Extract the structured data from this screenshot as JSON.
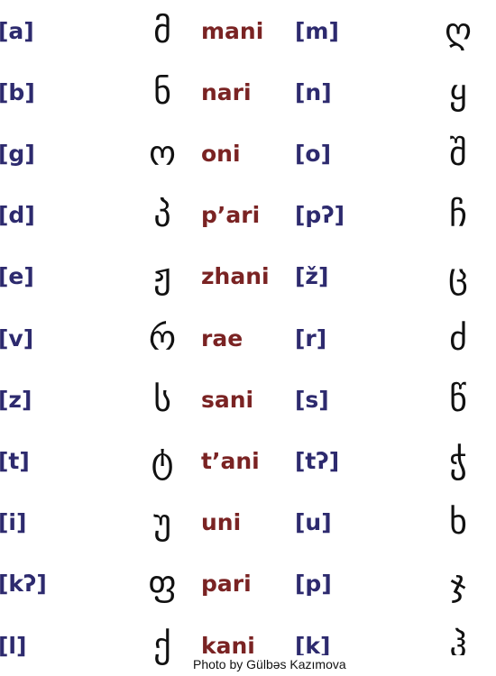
{
  "rows": [
    {
      "ipa": "[a]",
      "letter": "მ",
      "name": "mani",
      "ipa_right": "[m]",
      "letter_right": "ღ"
    },
    {
      "ipa": "[b]",
      "letter": "ნ",
      "name": "nari",
      "ipa_right": "[n]",
      "letter_right": "ყ"
    },
    {
      "ipa": "[g]",
      "letter": "ო",
      "name": "oni",
      "ipa_right": "[o]",
      "letter_right": "შ"
    },
    {
      "ipa": "[d]",
      "letter": "პ",
      "name": "p’ari",
      "ipa_right": "[pʔ]",
      "letter_right": "ჩ"
    },
    {
      "ipa": "[e]",
      "letter": "ჟ",
      "name": "zhani",
      "ipa_right": "[ž]",
      "letter_right": "ც"
    },
    {
      "ipa": "[v]",
      "letter": "რ",
      "name": "rae",
      "ipa_right": "[r]",
      "letter_right": "ძ"
    },
    {
      "ipa": "[z]",
      "letter": "ს",
      "name": "sani",
      "ipa_right": "[s]",
      "letter_right": "წ"
    },
    {
      "ipa": "[t]",
      "letter": "ტ",
      "name": "t’ani",
      "ipa_right": "[tʔ]",
      "letter_right": "ჭ"
    },
    {
      "ipa": "[i]",
      "letter": "უ",
      "name": "uni",
      "ipa_right": "[u]",
      "letter_right": "ხ"
    },
    {
      "ipa": "[kʔ]",
      "letter": "ფ",
      "name": "pari",
      "ipa_right": "[p]",
      "letter_right": "ჯ"
    },
    {
      "ipa": "[l]",
      "letter": "ქ",
      "name": "kani",
      "ipa_right": "[k]",
      "letter_right": "ჰ"
    }
  ],
  "caption": "Photo by Gülbəs Kazımova",
  "colors": {
    "ipa": "#2d2a6e",
    "name": "#7a2323",
    "letter": "#111111",
    "background": "#ffffff"
  }
}
